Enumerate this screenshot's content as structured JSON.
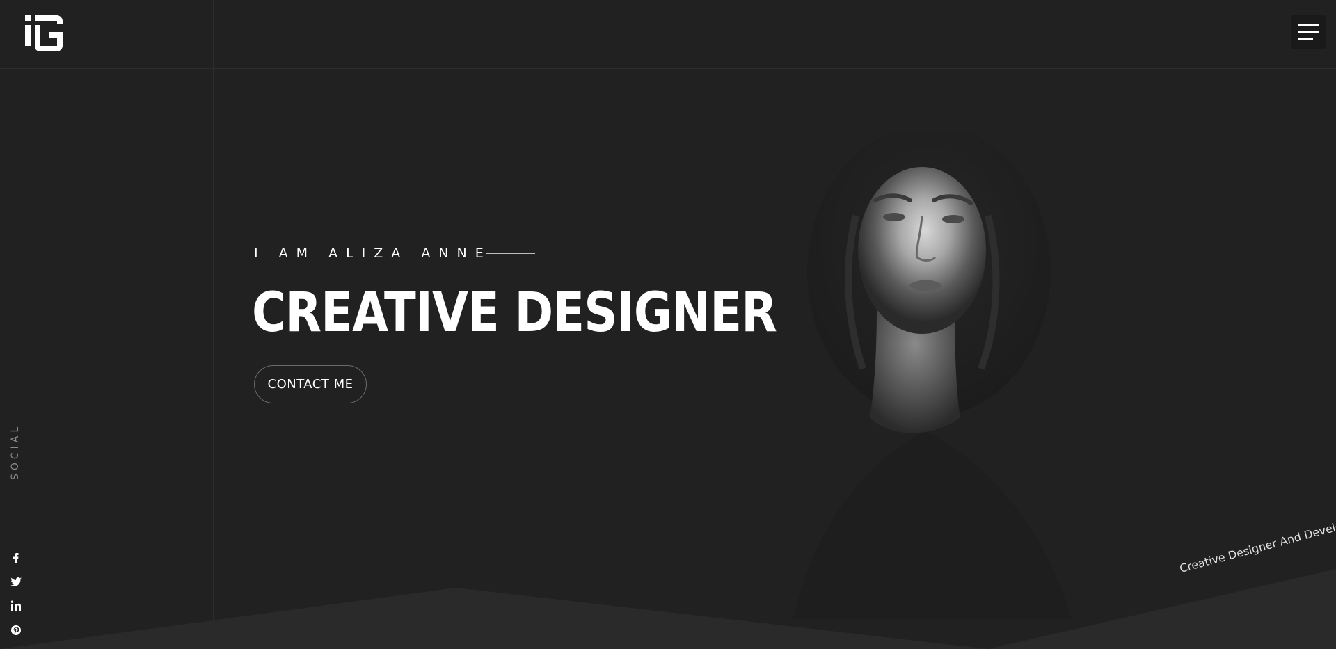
{
  "header": {
    "logo_icon": "ig-monogram-logo",
    "menu_icon": "hamburger-icon"
  },
  "hero": {
    "intro": "I AM ALIZA ANNE",
    "title": "CREATIVE DESIGNER",
    "contact_label": "CONTACT ME",
    "portrait": "black-and-white-portrait"
  },
  "social": {
    "label": "SOCIAL",
    "links": [
      {
        "icon": "facebook-icon"
      },
      {
        "icon": "twitter-icon"
      },
      {
        "icon": "linkedin-icon"
      },
      {
        "icon": "pinterest-icon"
      }
    ]
  },
  "tagline": "Creative Designer And Developer",
  "colors": {
    "background": "#212121",
    "text": "#ffffff",
    "muted": "#8a8a8a"
  }
}
